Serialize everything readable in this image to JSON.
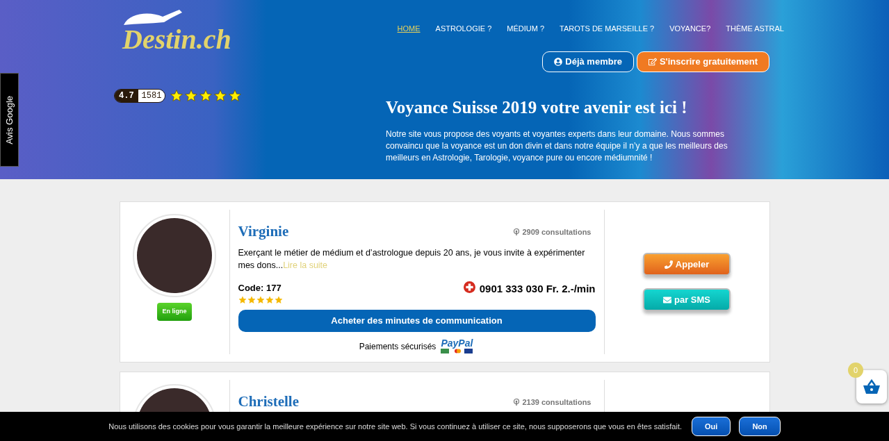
{
  "header": {
    "logo": "Destin.ch",
    "nav": [
      {
        "label": "HOME",
        "selected": true
      },
      {
        "label": "ASTROLOGIE ?",
        "selected": false
      },
      {
        "label": "MÉDIUM ?",
        "selected": false
      },
      {
        "label": "TAROTS DE MARSEILLE ?",
        "selected": false
      },
      {
        "label": "VOYANCE?",
        "selected": false
      },
      {
        "label": "THÈME ASTRAL",
        "selected": false
      }
    ],
    "buttons": [
      {
        "label": "Déjà membre",
        "kind": "outline"
      },
      {
        "label": "S'inscrire gratuitement",
        "kind": "primary"
      }
    ],
    "rating": {
      "score": "4.7",
      "count": "1581",
      "stars": 5
    },
    "headline": "Voyance Suisse 2019 votre avenir est ici !",
    "intro": "Notre site vous propose des voyants et voyantes experts dans leur domaine. Nous sommes convaincu que la voyance est un don divin et dans notre équipe il n’y a que les meilleurs des meilleurs en Astrologie, Tarologie, voyance pure ou encore médiumnité !"
  },
  "side_tab": "Avis Google",
  "profiles": [
    {
      "name": "Virginie",
      "consultations": "2909 consultations",
      "status": "En ligne",
      "description": "Exerçant le métier de médium et d’astrologue depuis 20 ans, je vous invite à expérimenter mes dons...",
      "read_more": "Lire la suite",
      "code": "Code: 177",
      "stars": 5,
      "phone": "0901 333 030 Fr. 2.-/min",
      "buy_button": "Acheter des minutes de communication",
      "payment_label": "Paiements sécurisés",
      "paypal": "PayPal",
      "actions": [
        {
          "label": "Appeler",
          "kind": "call"
        },
        {
          "label": "par SMS",
          "kind": "sms"
        }
      ]
    },
    {
      "name": "Christelle",
      "consultations": "2139 consultations"
    }
  ],
  "cart": {
    "count": "0"
  },
  "cookie_bar": {
    "message": "Nous utilisons des cookies pour vous garantir la meilleure expérience sur notre site web. Si vous continuez à utiliser ce site, nous supposerons que vous en êtes satisfait.",
    "buttons": [
      "Oui",
      "Non"
    ]
  }
}
